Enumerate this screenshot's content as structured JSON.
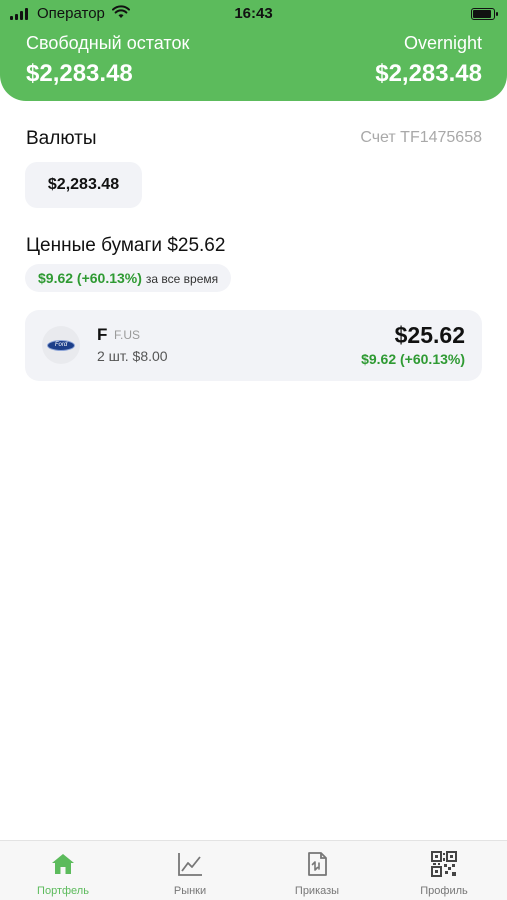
{
  "status_bar": {
    "carrier": "Оператор",
    "time": "16:43"
  },
  "header": {
    "free_balance_label": "Свободный остаток",
    "free_balance_value": "$2,283.48",
    "overnight_label": "Overnight",
    "overnight_value": "$2,283.48",
    "color": "#5cbb5c"
  },
  "currencies": {
    "title": "Валюты",
    "account": "Счет TF1475658",
    "chips": [
      "$2,283.48"
    ]
  },
  "securities": {
    "title": "Ценные бумаги $25.62",
    "total_gain": "$9.62 (+60.13%)",
    "gain_period": "за все время",
    "holdings": [
      {
        "ticker": "F",
        "exchange": "F.US",
        "quantity": "2 шт. $8.00",
        "value": "$25.62",
        "gain": "$9.62 (+60.13%)",
        "logo": "ford-logo"
      }
    ]
  },
  "tabbar": {
    "active": 0,
    "accent": "#5cbb5c",
    "items": [
      {
        "label": "Портфель",
        "icon": "home-icon"
      },
      {
        "label": "Рынки",
        "icon": "chart-icon"
      },
      {
        "label": "Приказы",
        "icon": "orders-icon"
      },
      {
        "label": "Профиль",
        "icon": "qr-code-icon"
      }
    ]
  }
}
